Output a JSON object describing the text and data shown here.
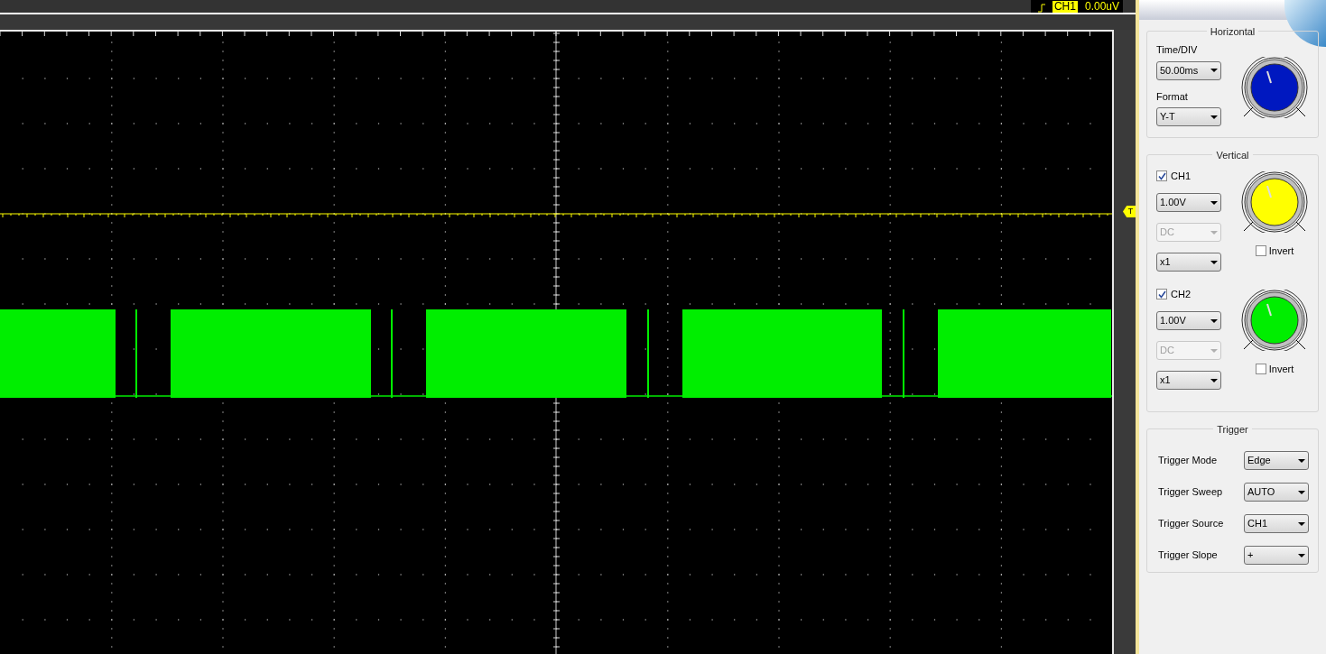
{
  "top_bar": {
    "trigger_channel": "CH1",
    "trigger_level": "0.00uV"
  },
  "scope": {
    "trigger_marker": "T"
  },
  "horizontal": {
    "title": "Horizontal",
    "time_div_label": "Time/DIV",
    "time_div": "50.00ms",
    "format_label": "Format",
    "format": "Y-T"
  },
  "vertical": {
    "title": "Vertical",
    "channels": [
      {
        "name": "CH1",
        "checked": true,
        "volts": "1.00V",
        "coupling": "DC",
        "coupling_disabled": true,
        "probe": "x1",
        "invert_label": "Invert",
        "invert": false,
        "color": "#ffff00"
      },
      {
        "name": "CH2",
        "checked": true,
        "volts": "1.00V",
        "coupling": "DC",
        "coupling_disabled": true,
        "probe": "x1",
        "invert_label": "Invert",
        "invert": false,
        "color": "#00ee00"
      }
    ]
  },
  "trigger": {
    "title": "Trigger",
    "rows": [
      {
        "label": "Trigger Mode",
        "value": "Edge"
      },
      {
        "label": "Trigger Sweep",
        "value": "AUTO"
      },
      {
        "label": "Trigger Source",
        "value": "CH1"
      },
      {
        "label": "Trigger Slope",
        "value": "+"
      }
    ]
  }
}
